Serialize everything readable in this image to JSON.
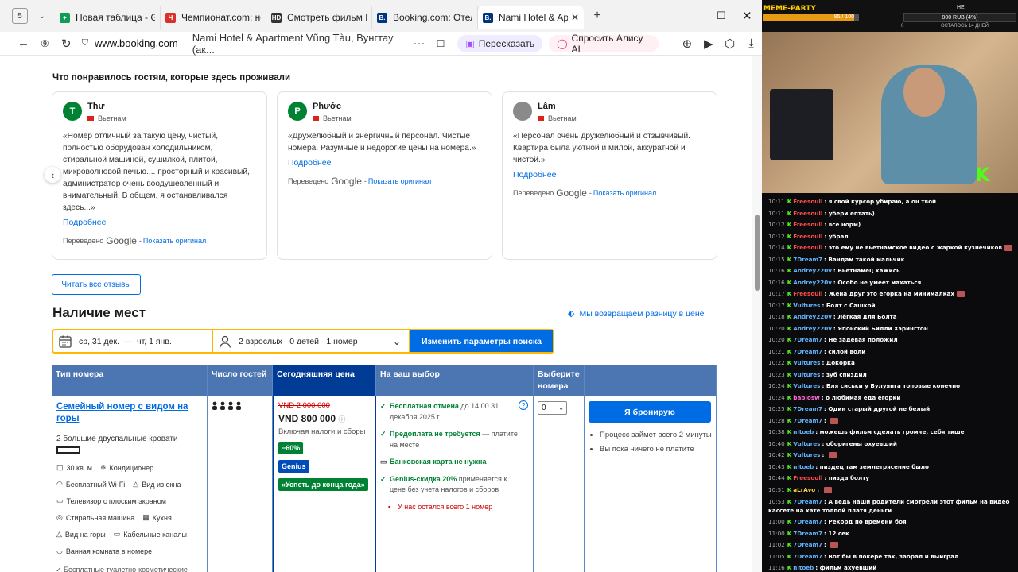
{
  "browser": {
    "tab_count": "5",
    "tabs": [
      {
        "label": "Новая таблица - Goo",
        "fav": "+",
        "color": "#0f9d58"
      },
      {
        "label": "Чемпионат.com: нов",
        "fav": "Ч",
        "color": "#d6322b"
      },
      {
        "label": "Смотреть фильм Игр",
        "fav": "HD",
        "color": "#333333"
      },
      {
        "label": "Booking.com: Отели п",
        "fav": "B.",
        "color": "#003580"
      },
      {
        "label": "Nami Hotel & Apar",
        "fav": "B.",
        "color": "#003580"
      }
    ],
    "url_domain": "www.booking.com",
    "url_title": "Nami Hotel & Apartment Vũng Tàu, Вунгтау (ак...",
    "retell_label": "Пересказать",
    "alice_label": "Спросить Алису AI"
  },
  "reviews": {
    "heading": "Что понравилось гостям, которые здесь проживали",
    "items": [
      {
        "initial": "T",
        "name": "Thư",
        "country": "Вьетнам",
        "text": "«Номер отличный за такую цену, чистый, полностью оборудован холодильником, стиральной машиной, сушилкой, плитой, микроволновой печью.... просторный и красивый, администратор очень воодушевленный и внимательный. В общем, я останавливался здесь...»",
        "more": "Подробнее",
        "translated": "Переведено",
        "google": "Google",
        "original": "Показать оригинал"
      },
      {
        "initial": "P",
        "name": "Phước",
        "country": "Вьетнам",
        "text": "«Дружелюбный и энергичный персонал. Чистые номера. Разумные и недорогие цены на номера.»",
        "more": "Подробнее",
        "translated": "Переведено",
        "google": "Google",
        "original": "Показать оригинал"
      },
      {
        "initial": "",
        "name": "Lâm",
        "country": "Вьетнам",
        "text": "«Персонал очень дружелюбный и отзывчивый. Квартира была уютной и милой, аккуратной и чистой.»",
        "more": "Подробнее",
        "translated": "Переведено",
        "google": "Google",
        "original": "Показать оригинал"
      }
    ],
    "read_all": "Читать все отзывы"
  },
  "availability": {
    "heading": "Наличие мест",
    "price_match": "Мы возвращаем разницу в цене",
    "dates": "ср, 31 дек.  —  чт, 1 янв.",
    "guests": "2 взрослых · 0 детей · 1 номер",
    "change_button": "Изменить параметры поиска"
  },
  "table": {
    "headers": [
      "Тип номера",
      "Число гостей",
      "Сегодняшняя цена",
      "На ваш выбор",
      "Выберите номера",
      ""
    ],
    "room": {
      "name": "Семейный номер с видом на горы",
      "beds": "2 большие двуспальные кровати",
      "facilities": [
        {
          "icon": "◫",
          "label": "30 кв. м"
        },
        {
          "icon": "❄",
          "label": "Кондиционер"
        },
        {
          "icon": "◠",
          "label": "Бесплатный Wi-Fi"
        },
        {
          "icon": "△",
          "label": "Вид из окна"
        },
        {
          "icon": "▭",
          "label": "Телевизор с плоским экраном"
        },
        {
          "icon": "◎",
          "label": "Стиральная машина"
        },
        {
          "icon": "▦",
          "label": "Кухня"
        },
        {
          "icon": "△",
          "label": "Вид на горы"
        },
        {
          "icon": "▭",
          "label": "Кабельные каналы"
        },
        {
          "icon": "◡",
          "label": "Ванная комната в номере"
        }
      ],
      "more": "✓ Бесплатные туалетно-косметические",
      "persons": "👤👤👤👤",
      "old_price": "VND 2 000 000",
      "price": "VND 800 000",
      "taxes": "Включая налоги и сборы",
      "discount": "−60%",
      "genius": "Genius",
      "deal": "«Успеть до конца года»",
      "choices": [
        {
          "b": "Бесплатная отмена",
          "t": " до 14:00 31 декабря 2025 г."
        },
        {
          "b": "Предоплата не требуется",
          "t": " — платите на месте"
        },
        {
          "b": "Банковская карта не нужна",
          "t": ""
        },
        {
          "b": "Genius-скидка 20%",
          "t": " применяется к цене без учета налогов и сборов"
        }
      ],
      "left": "У нас остался всего 1 номер",
      "select_value": "0",
      "book": "Я бронирую",
      "notes": [
        "Процесс займет всего 2 минуты",
        "Вы пока ничего не платите"
      ]
    }
  },
  "stream": {
    "brand": "MEME-PARTY",
    "xp": "95 / 100",
    "xp_fraction": 0.95,
    "top_label": "НЕ",
    "goal": "800 RUB (4%)",
    "goal_left": "0",
    "goal_sub": "ОСТАЛОСЬ 14 ДНЕЙ"
  },
  "chat": [
    {
      "t": "10:11",
      "u": "Freesoull",
      "c": "#ff4d4d",
      "m": "я свой курсор убираю, а он твой"
    },
    {
      "t": "10:11",
      "u": "Freesoull",
      "c": "#ff4d4d",
      "m": "убери ептать)"
    },
    {
      "t": "10:12",
      "u": "Freesoull",
      "c": "#ff4d4d",
      "m": "все норм)"
    },
    {
      "t": "10:12",
      "u": "Freesoull",
      "c": "#ff4d4d",
      "m": "убрал"
    },
    {
      "t": "10:14",
      "u": "Freesoull",
      "c": "#ff4d4d",
      "m": "это ему не вьетнамское видео с жаркой кузнечиков",
      "e": true
    },
    {
      "t": "10:15",
      "u": "7Dream7",
      "c": "#63b3ff",
      "m": "Вандам такой мальчик"
    },
    {
      "t": "10:16",
      "u": "Andrey220v",
      "c": "#63b3ff",
      "m": "Вьетнамец кажись"
    },
    {
      "t": "10:16",
      "u": "Andrey220v",
      "c": "#63b3ff",
      "m": "Особо не умеет махаться"
    },
    {
      "t": "10:17",
      "u": "Freesoull",
      "c": "#ff4d4d",
      "m": "Жена друг это егорка на минималках",
      "e": true
    },
    {
      "t": "10:17",
      "u": "Vultures",
      "c": "#63b3ff",
      "m": "Болт с Сашкой"
    },
    {
      "t": "10:18",
      "u": "Andrey220v",
      "c": "#63b3ff",
      "m": "Лёгкая для Болта"
    },
    {
      "t": "10:20",
      "u": "Andrey220v",
      "c": "#63b3ff",
      "m": "Японский Билли Хэрингтон"
    },
    {
      "t": "10:20",
      "u": "7Dream7",
      "c": "#63b3ff",
      "m": "Не задевая положил"
    },
    {
      "t": "10:21",
      "u": "7Dream7",
      "c": "#63b3ff",
      "m": "силой воли"
    },
    {
      "t": "10:22",
      "u": "Vultures",
      "c": "#63b3ff",
      "m": "Докорка"
    },
    {
      "t": "10:23",
      "u": "Vultures",
      "c": "#63b3ff",
      "m": "зуб спиздил"
    },
    {
      "t": "10:24",
      "u": "Vultures",
      "c": "#63b3ff",
      "m": "Бля сиськи у Булуянга топовые конечно"
    },
    {
      "t": "10:24",
      "u": "bablosw",
      "c": "#ff6bd6",
      "m": "о любимая еда егорки"
    },
    {
      "t": "10:25",
      "u": "7Dream7",
      "c": "#63b3ff",
      "m": "Один старый другой не белый"
    },
    {
      "t": "10:28",
      "u": "7Dream7",
      "c": "#63b3ff",
      "m": "",
      "e": true
    },
    {
      "t": "10:38",
      "u": "nitoeb",
      "c": "#63b3ff",
      "m": "можешь фильм сделать громче, себя тише"
    },
    {
      "t": "10:40",
      "u": "Vultures",
      "c": "#63b3ff",
      "m": "оборигены охуевший"
    },
    {
      "t": "10:42",
      "u": "Vultures",
      "c": "#63b3ff",
      "m": "",
      "e": true
    },
    {
      "t": "10:43",
      "u": "nitoeb",
      "c": "#63b3ff",
      "m": "пиздец там землетрясение было"
    },
    {
      "t": "10:44",
      "u": "Freesoull",
      "c": "#ff4d4d",
      "m": "пизда болту"
    },
    {
      "t": "10:51",
      "u": "aLrAvo",
      "c": "#ffd24d",
      "m": "",
      "e": true
    },
    {
      "t": "10:53",
      "u": "7Dream7",
      "c": "#63b3ff",
      "m": "А ведь наши родители смотрели этот фильм на видео кассете на хате толпой платя деньги",
      "w": true
    },
    {
      "t": "11:00",
      "u": "7Dream7",
      "c": "#63b3ff",
      "m": "Рекорд по времени боя"
    },
    {
      "t": "11:00",
      "u": "7Dream7",
      "c": "#63b3ff",
      "m": "12 сек"
    },
    {
      "t": "11:02",
      "u": "7Dream7",
      "c": "#63b3ff",
      "m": "",
      "e": true
    },
    {
      "t": "11:05",
      "u": "7Dream7",
      "c": "#63b3ff",
      "m": "Вот бы в покере так, заорал и выиграл"
    },
    {
      "t": "11:16",
      "u": "nitoeb",
      "c": "#63b3ff",
      "m": "фильм ахуевший"
    }
  ]
}
